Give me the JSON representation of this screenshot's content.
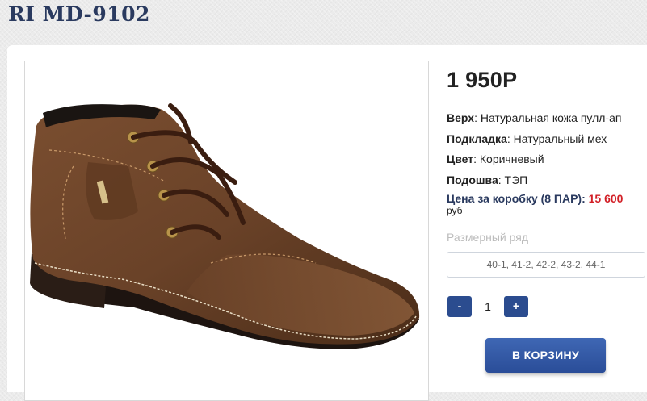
{
  "product": {
    "title": "RI MD-9102",
    "price": "1 950Р",
    "image_alt": "brown leather lace-up ankle boot"
  },
  "specs": [
    {
      "label": "Верх",
      "value": ": Натуральная кожа пулл-ап"
    },
    {
      "label": "Подкладка",
      "value": ": Натуральный мех"
    },
    {
      "label": "Цвет",
      "value": ": Коричневый"
    },
    {
      "label": "Подошва",
      "value": ": ТЭП"
    }
  ],
  "box_price": {
    "label": "Цена за коробку (8 ПАР):",
    "value": "15 600",
    "unit": "руб"
  },
  "sizes": {
    "label": "Размерный ряд",
    "selected": "40-1, 41-2, 42-2, 43-2, 44-1"
  },
  "quantity": {
    "minus": "-",
    "value": "1",
    "plus": "+"
  },
  "cart_button": "В КОРЗИНУ",
  "colors": {
    "title": "#2a3a5f",
    "accent_blue": "#2b4c8f",
    "price_red": "#d21f26",
    "boot_brown": "#6b4328"
  }
}
